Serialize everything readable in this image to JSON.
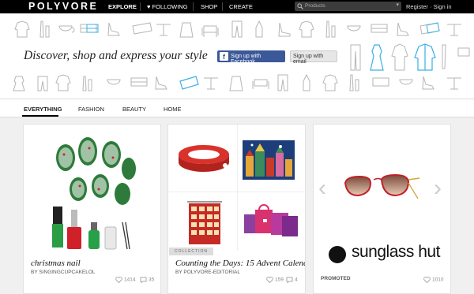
{
  "topbar": {
    "logo": "POLYVORE",
    "nav": [
      "EXPLORE",
      "FOLLOWING",
      "SHOP",
      "CREATE"
    ],
    "search_placeholder": "Products",
    "register": "Register",
    "separator": "·",
    "signin": "Sign in"
  },
  "banner": {
    "tagline": "Discover, shop and express your style",
    "facebook_button": "Sign up with Facebook",
    "email_button": "Sign up with email"
  },
  "tabs": [
    "EVERYTHING",
    "FASHION",
    "BEAUTY",
    "HOME"
  ],
  "cards": [
    {
      "title": "christmas nail",
      "by": "BY SINGINGCUPCAKELOL",
      "likes": "1414",
      "comments": "35"
    },
    {
      "tag": "COLLECTION",
      "title": "Counting the Days: 15 Advent Calend...",
      "by": "BY POLYVORE-EDITORIAL",
      "likes": "159",
      "comments": "4"
    },
    {
      "promoted": "PROMOTED",
      "brand": "sunglass hut",
      "likes": "1010"
    }
  ],
  "colors": {
    "facebook": "#3b5998",
    "accent": "#3ab0e6",
    "topbar": "#000000"
  }
}
